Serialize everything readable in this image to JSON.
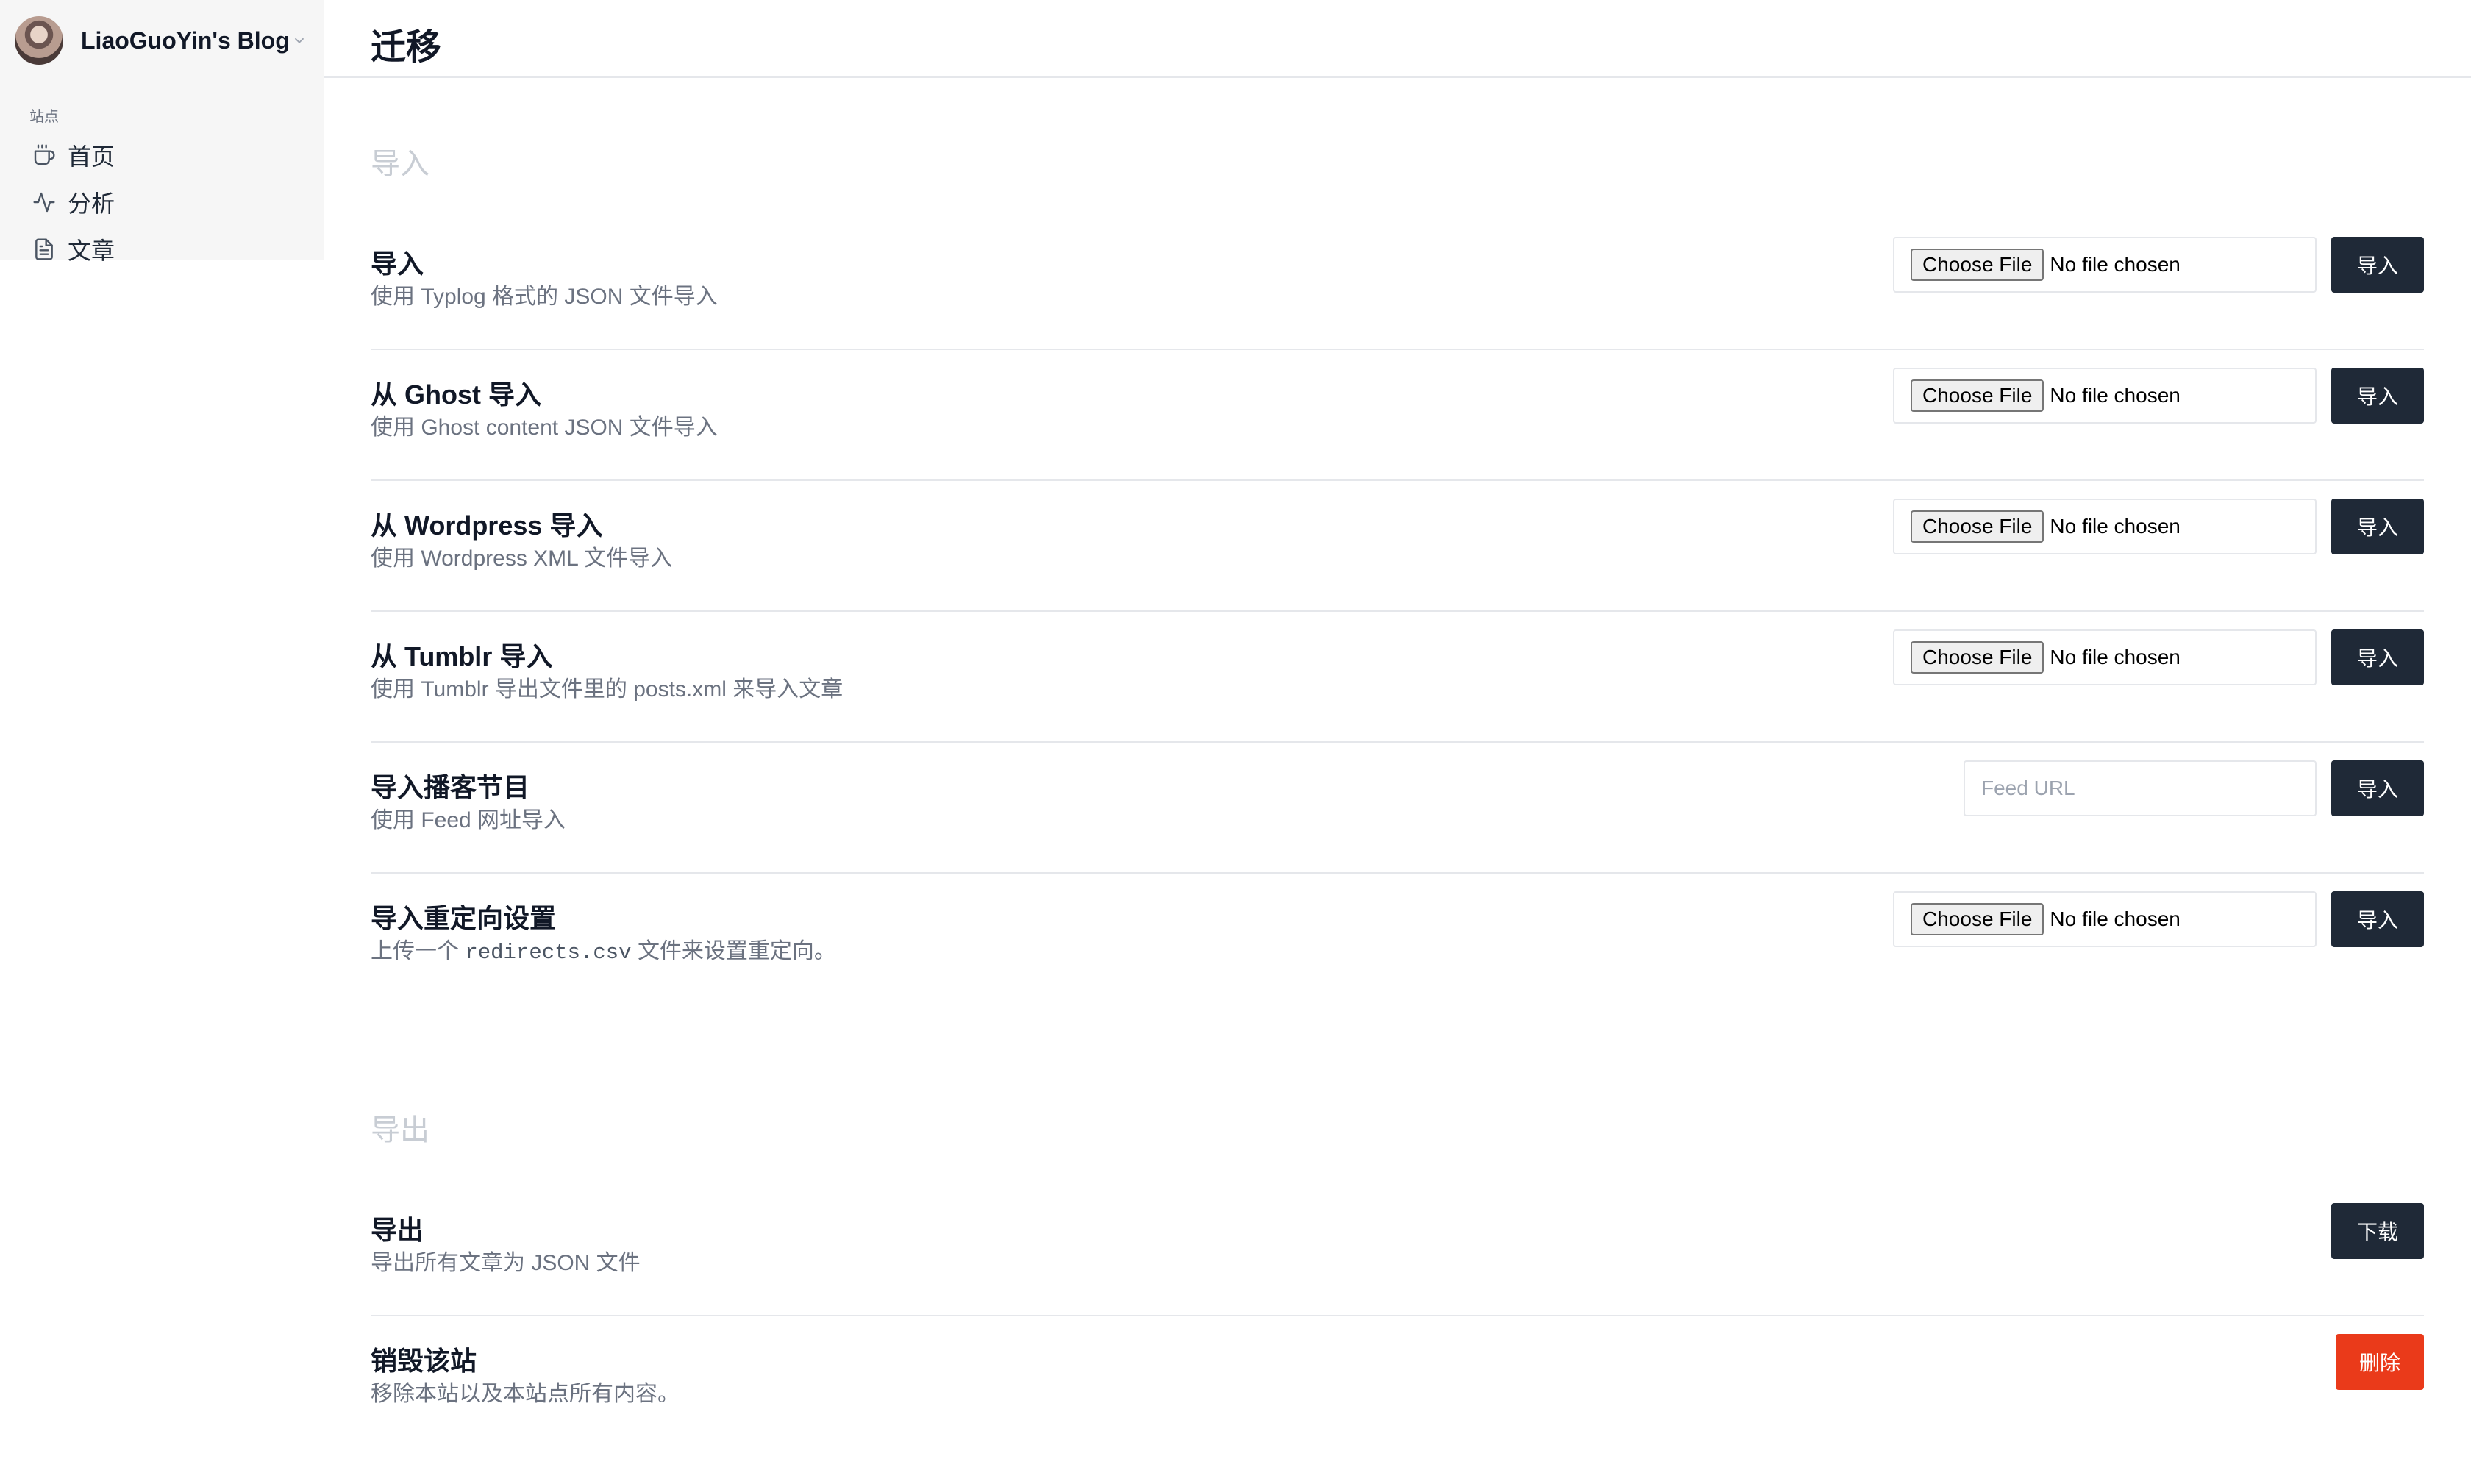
{
  "sidebar": {
    "site_name": "LiaoGuoYin's Blog",
    "section_label": "站点",
    "items": [
      {
        "label": "首页",
        "icon": "coffee-icon"
      },
      {
        "label": "分析",
        "icon": "activity-icon"
      },
      {
        "label": "文章",
        "icon": "document-icon"
      }
    ]
  },
  "header": {
    "title": "迁移"
  },
  "import_section": {
    "heading": "导入",
    "rows": [
      {
        "title": "导入",
        "desc": "使用 Typlog 格式的 JSON 文件导入",
        "choose_label": "Choose File",
        "file_status": "No file chosen",
        "button": "导入"
      },
      {
        "title": "从 Ghost 导入",
        "desc": "使用 Ghost content JSON 文件导入",
        "choose_label": "Choose File",
        "file_status": "No file chosen",
        "button": "导入"
      },
      {
        "title": "从 Wordpress 导入",
        "desc": "使用 Wordpress XML 文件导入",
        "choose_label": "Choose File",
        "file_status": "No file chosen",
        "button": "导入"
      },
      {
        "title": "从 Tumblr 导入",
        "desc": "使用 Tumblr 导出文件里的 posts.xml 来导入文章",
        "choose_label": "Choose File",
        "file_status": "No file chosen",
        "button": "导入"
      },
      {
        "title": "导入播客节目",
        "desc": "使用 Feed 网址导入",
        "placeholder": "Feed URL",
        "button": "导入"
      },
      {
        "title": "导入重定向设置",
        "desc_before": "上传一个",
        "desc_code": "redirects.csv",
        "desc_after": "文件来设置重定向。",
        "choose_label": "Choose File",
        "file_status": "No file chosen",
        "button": "导入"
      }
    ]
  },
  "export_section": {
    "heading": "导出",
    "export_row": {
      "title": "导出",
      "desc": "导出所有文章为 JSON 文件",
      "button": "下载"
    },
    "destroy_row": {
      "title": "销毁该站",
      "desc": "移除本站以及本站点所有内容。",
      "button": "删除"
    }
  },
  "colors": {
    "primary_button": "#1f2937",
    "danger_button": "#ea3a1a",
    "section_heading": "#c8cdd4",
    "sidebar_bg": "#f6f6f6"
  }
}
